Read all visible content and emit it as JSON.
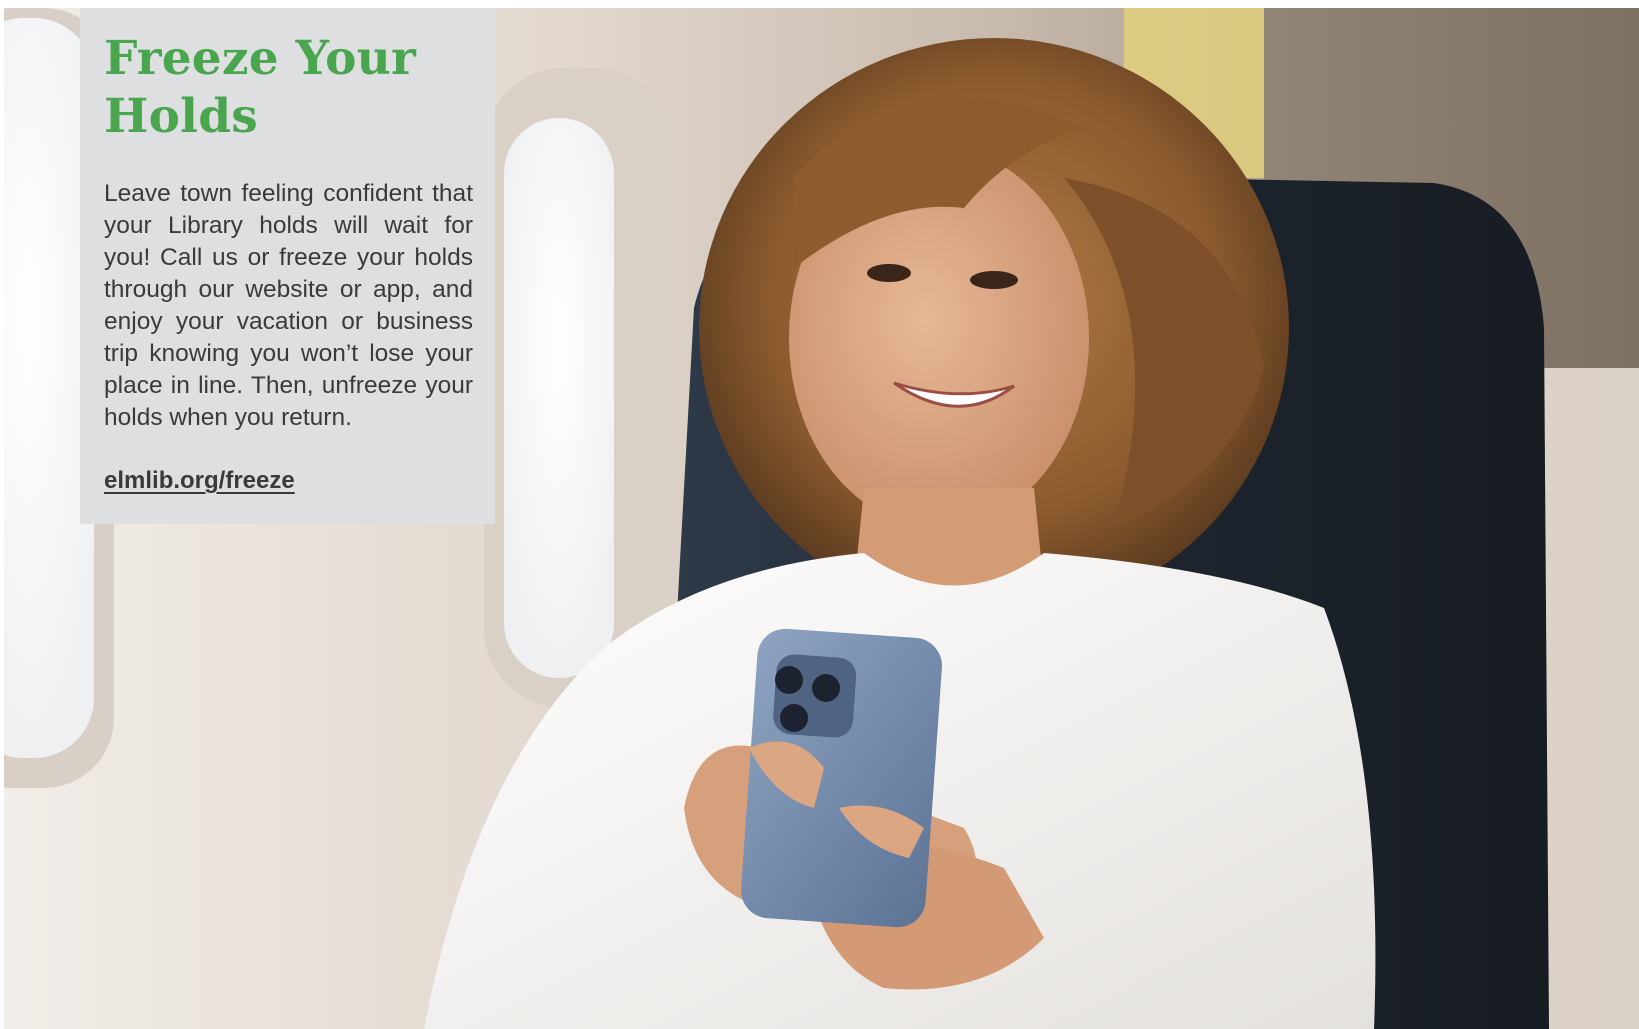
{
  "panel": {
    "title": "Freeze Your Holds",
    "body": "Leave town feeling confident that your Library holds will wait for you! Call us or freeze your holds through our website or app, and enjoy your vacation or business trip knowing you won’t lose your place in line. Then, unfreeze your holds when you return.",
    "link": "elmlib.org/freeze"
  },
  "colors": {
    "title_green": "#4aa54f",
    "panel_bg": "#dedfe0",
    "body_text": "#3a3a3a"
  }
}
